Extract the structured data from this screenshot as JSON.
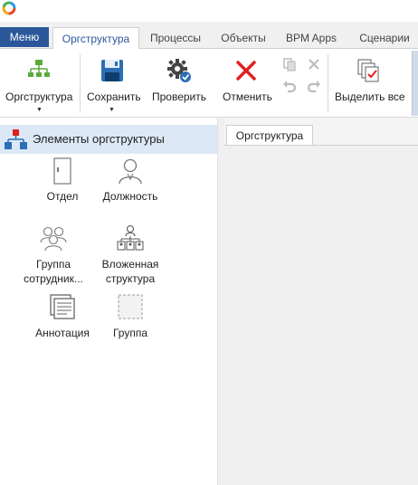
{
  "app": {
    "logo_icon": "app-logo-icon"
  },
  "tabs": {
    "menu": "Меню",
    "items": [
      {
        "label": "Оргструктура",
        "active": true
      },
      {
        "label": "Процессы",
        "active": false
      },
      {
        "label": "Объекты",
        "active": false
      },
      {
        "label": "BPM Apps",
        "active": false
      },
      {
        "label": "Сценарии",
        "active": false
      }
    ]
  },
  "ribbon": {
    "orgstructure": {
      "label": "Оргструктура",
      "icon": "org-chart-icon"
    },
    "save": {
      "label": "Сохранить",
      "icon": "floppy-disk-icon"
    },
    "check": {
      "label": "Проверить",
      "icon": "gear-check-icon"
    },
    "cancel": {
      "label": "Отменить",
      "icon": "red-x-icon"
    },
    "select_all": {
      "label": "Выделить все",
      "icon": "select-all-icon"
    },
    "small_tools": [
      "copy-icon",
      "delete-icon",
      "undo-icon",
      "redo-icon"
    ]
  },
  "panel": {
    "title": "Элементы оргструктуры",
    "icon": "org-hierarchy-icon",
    "elements": [
      {
        "label": "Отдел",
        "icon": "department-icon"
      },
      {
        "label": "Должность",
        "icon": "position-person-icon"
      },
      {
        "label": "Группа\nсотрудник...",
        "icon": "employee-group-icon"
      },
      {
        "label": "Вложенная\nструктура",
        "icon": "nested-structure-icon"
      },
      {
        "label": "Аннотация",
        "icon": "annotation-icon"
      },
      {
        "label": "Группа",
        "icon": "group-dashed-icon"
      }
    ]
  },
  "document": {
    "tab_label": "Оргструктура"
  },
  "colors": {
    "accent": "#2b579a",
    "panel_header": "#dde8f6",
    "cancel_red": "#e02020"
  }
}
